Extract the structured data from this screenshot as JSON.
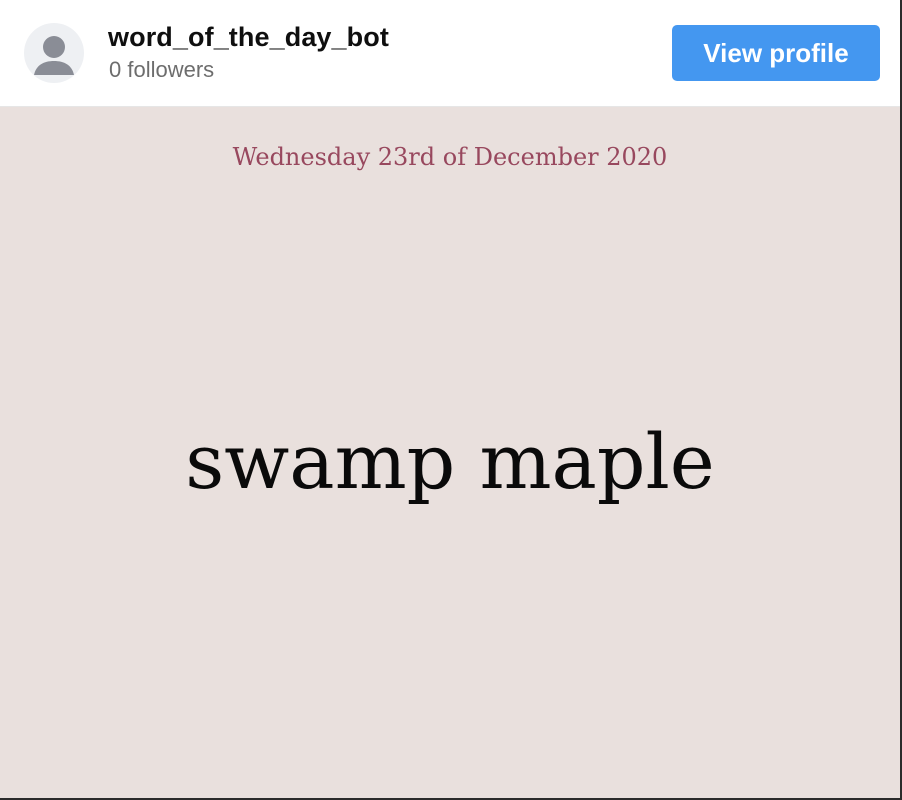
{
  "header": {
    "username": "word_of_the_day_bot",
    "followers_text": "0 followers",
    "view_profile_label": "View profile",
    "avatar_icon": "user-silhouette-icon"
  },
  "post": {
    "date": "Wednesday 23rd of December 2020",
    "word": "swamp maple"
  },
  "colors": {
    "button_bg": "#4497f0",
    "card_bg": "#e9e0dd",
    "date_text": "#98485e"
  }
}
